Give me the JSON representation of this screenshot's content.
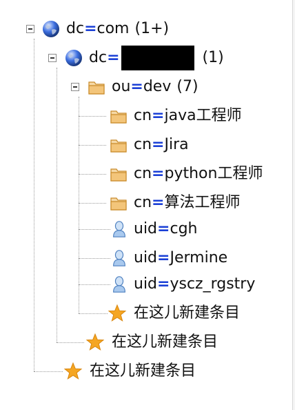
{
  "tree": {
    "root": {
      "prefix": "dc",
      "eq": "=",
      "value": "com",
      "count": "(1+)",
      "icon": "globe-icon"
    },
    "dc_node": {
      "prefix": "dc",
      "eq": "=",
      "value": "",
      "count": "(1)",
      "icon": "globe-icon",
      "redacted": true
    },
    "ou_node": {
      "prefix": "ou",
      "eq": "=",
      "value": "dev",
      "count": "(7)",
      "icon": "folder-icon"
    },
    "children": [
      {
        "prefix": "cn",
        "eq": "=",
        "value": "java工程师",
        "icon": "folder-icon"
      },
      {
        "prefix": "cn",
        "eq": "=",
        "value": "Jira",
        "icon": "folder-icon"
      },
      {
        "prefix": "cn",
        "eq": "=",
        "value": "python工程师",
        "icon": "folder-icon"
      },
      {
        "prefix": "cn",
        "eq": "=",
        "value": "算法工程师",
        "icon": "folder-icon"
      },
      {
        "prefix": "uid",
        "eq": "=",
        "value": "cgh",
        "icon": "user-icon"
      },
      {
        "prefix": "uid",
        "eq": "=",
        "value": "Jermine",
        "icon": "user-icon"
      },
      {
        "prefix": "uid",
        "eq": "=",
        "value": "yscz_rgstry",
        "icon": "user-icon"
      }
    ],
    "new_entry_label": "在这儿新建条目"
  },
  "colors": {
    "equals": "#1a3fd6",
    "globe": "#2f5fd0",
    "folder": "#f0b35a",
    "star": "#f5a623",
    "user": "#9cc4ec"
  }
}
